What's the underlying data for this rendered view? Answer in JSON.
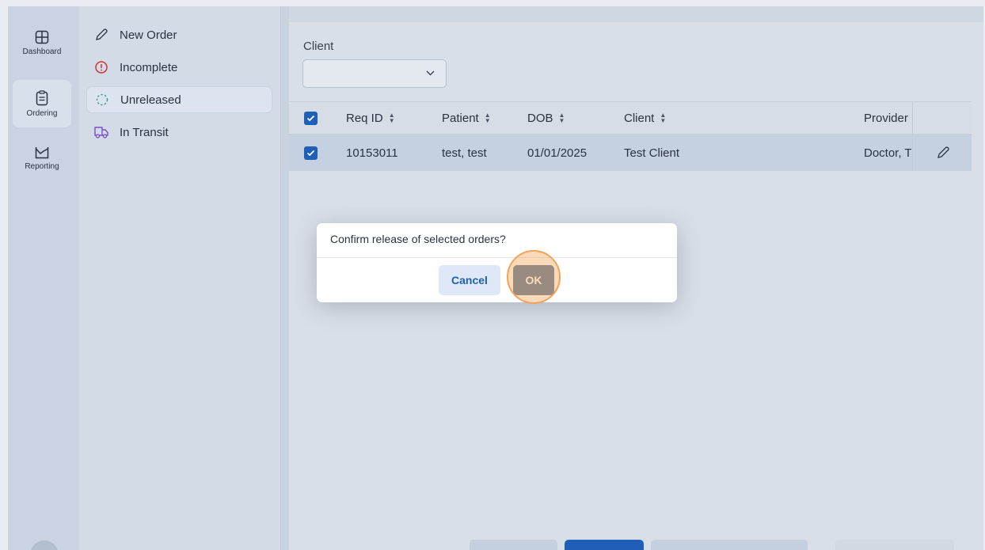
{
  "rail": {
    "items": [
      {
        "label": "Dashboard",
        "icon": "dashboard-icon"
      },
      {
        "label": "Ordering",
        "icon": "clipboard-icon",
        "active": true
      },
      {
        "label": "Reporting",
        "icon": "chart-icon"
      }
    ]
  },
  "subnav": {
    "items": [
      {
        "label": "New Order",
        "icon": "pencil-icon"
      },
      {
        "label": "Incomplete",
        "icon": "alert-circle-icon",
        "color": "#d0333b"
      },
      {
        "label": "Unreleased",
        "icon": "dashed-circle-icon",
        "color": "#2ba58f",
        "active": true
      },
      {
        "label": "In Transit",
        "icon": "truck-icon",
        "color": "#7b4fc9"
      }
    ]
  },
  "filter": {
    "label": "Client",
    "value": ""
  },
  "table": {
    "columns": [
      "Req ID",
      "Patient",
      "DOB",
      "Client",
      "Provider"
    ],
    "rows": [
      {
        "req_id": "10153011",
        "patient": "test, test",
        "dob": "01/01/2025",
        "client": "Test Client",
        "provider": "Doctor, T"
      }
    ]
  },
  "modal": {
    "message": "Confirm release of selected orders?",
    "cancel_label": "Cancel",
    "ok_label": "OK"
  },
  "colors": {
    "primary": "#1f5fb8",
    "ok_button": "#58779e",
    "highlight": "#f0a35a"
  }
}
